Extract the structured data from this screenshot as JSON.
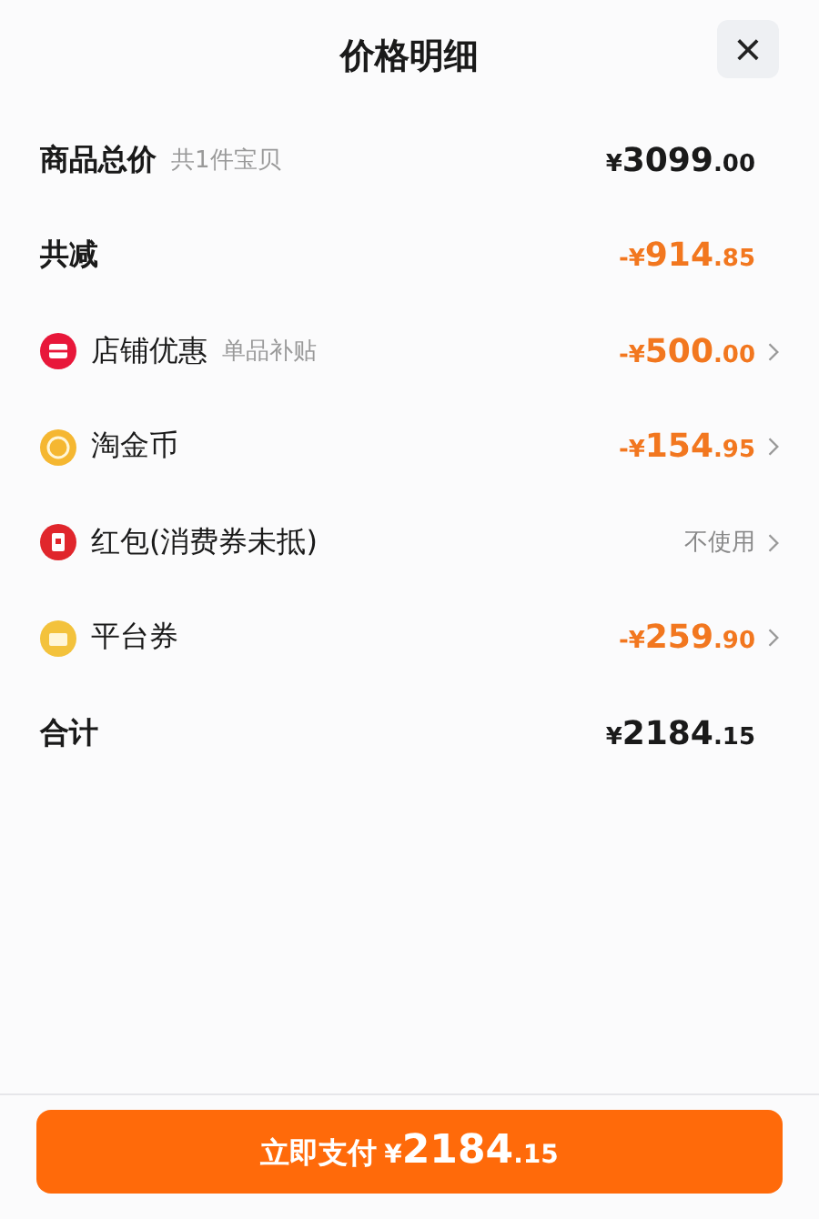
{
  "header": {
    "title": "价格明细",
    "close": "×"
  },
  "rows": [
    {
      "label": "商品总价",
      "note": "共1件宝贝",
      "kind": "plain",
      "amount": {
        "prefix": "¥",
        "integer": "3099",
        "decimal": ".00",
        "highlight": false
      },
      "arrow": false
    },
    {
      "label": "共减",
      "kind": "plain",
      "amount": {
        "prefix": "-¥",
        "integer": "914",
        "decimal": ".85",
        "highlight": true
      },
      "arrow": false
    },
    {
      "label": "店铺优惠",
      "note": "单品补贴",
      "kind": "shop",
      "amount": {
        "prefix": "-¥",
        "integer": "500",
        "decimal": ".00",
        "highlight": true
      },
      "arrow": true
    },
    {
      "label": "淘金币",
      "kind": "coin",
      "amount": {
        "prefix": "-¥",
        "integer": "154",
        "decimal": ".95",
        "highlight": true
      },
      "arrow": true
    },
    {
      "label": "红包(消费券未抵)",
      "kind": "redpacket",
      "status": "不使用",
      "arrow": true
    },
    {
      "label": "平台券",
      "kind": "coupon",
      "amount": {
        "prefix": "-¥",
        "integer": "259",
        "decimal": ".90",
        "highlight": true
      },
      "arrow": true
    },
    {
      "label": "合计",
      "kind": "plain",
      "amount": {
        "prefix": "¥",
        "integer": "2184",
        "decimal": ".15",
        "highlight": false
      },
      "arrow": false
    }
  ],
  "pay_button": {
    "label": "立即支付",
    "prefix": "¥",
    "integer": "2184",
    "decimal": ".15"
  }
}
